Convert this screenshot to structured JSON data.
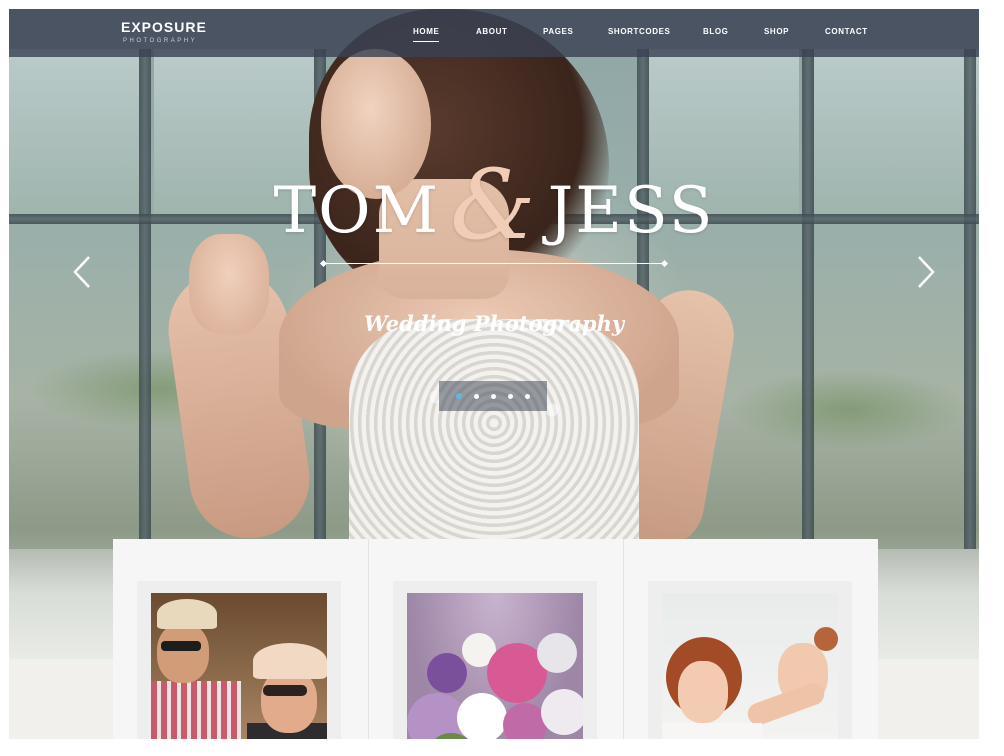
{
  "brand": {
    "title": "EXPOSURE",
    "subtitle": "PHOTOGRAPHY"
  },
  "nav": {
    "items": [
      {
        "label": "HOME",
        "active": true
      },
      {
        "label": "ABOUT",
        "active": false
      },
      {
        "label": "PAGES",
        "active": false
      },
      {
        "label": "SHORTCODES",
        "active": false
      },
      {
        "label": "BLOG",
        "active": false
      },
      {
        "label": "SHOP",
        "active": false
      },
      {
        "label": "CONTACT",
        "active": false
      }
    ]
  },
  "hero": {
    "name_left": "TOM",
    "ampersand": "&",
    "name_right": "JESS",
    "subtitle": "Wedding Photography",
    "prev_icon": "chevron-left-icon",
    "next_icon": "chevron-right-icon",
    "slide_count": 5,
    "active_slide": 1
  },
  "cards": [
    {
      "image": "couple-in-hats-photo"
    },
    {
      "image": "bridal-bouquet-photo"
    },
    {
      "image": "bride-hair-styling-photo"
    }
  ],
  "colors": {
    "navbar": "#3a4254",
    "accent_ampersand": "#f1cdb7",
    "active_dot": "#5fb8e0",
    "text": "#ffffff"
  }
}
